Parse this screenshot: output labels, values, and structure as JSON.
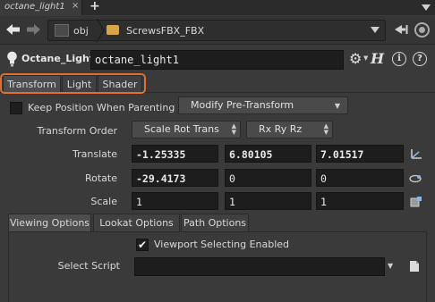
{
  "tab_bar": {
    "active_tab": "octane_light1",
    "close_glyph": "×",
    "add_glyph": "+"
  },
  "path_bar": {
    "crumbs": [
      {
        "label": "obj",
        "icon": "network-obj-icon"
      },
      {
        "label": "ScrewsFBX_FBX",
        "icon": "geometry-folder-icon"
      }
    ]
  },
  "node": {
    "type_label": "Octane_Light",
    "name": "octane_light1",
    "help_glyph": "H",
    "info_glyph": "i",
    "question_glyph": "?"
  },
  "main_tabs": [
    {
      "label": "Transform",
      "active": true
    },
    {
      "label": "Light",
      "active": false
    },
    {
      "label": "Shader",
      "active": false
    }
  ],
  "highlight_color": "#e26d2e",
  "params": {
    "keep_position_label": "Keep Position When Parenting",
    "keep_position_checked": false,
    "pretransform_option": "Modify Pre-Transform",
    "transform_order_label": "Transform Order",
    "transform_order_value": "Scale Rot Trans",
    "rotation_order_value": "Rx Ry Rz",
    "translate": {
      "label": "Translate",
      "values": [
        "-1.25335",
        "6.80105",
        "7.01517"
      ]
    },
    "rotate": {
      "label": "Rotate",
      "values": [
        "-29.4173",
        "0",
        "0"
      ]
    },
    "scale": {
      "label": "Scale",
      "values": [
        "1",
        "1",
        "1"
      ]
    }
  },
  "sub_tabs": [
    {
      "label": "Viewing Options",
      "active": true
    },
    {
      "label": "Lookat Options",
      "active": false
    },
    {
      "label": "Path Options",
      "active": false
    }
  ],
  "viewing": {
    "viewport_selecting_label": "Viewport Selecting Enabled",
    "viewport_selecting_checked": true,
    "check_glyph": "✔",
    "select_script_label": "Select Script",
    "select_script_value": ""
  }
}
